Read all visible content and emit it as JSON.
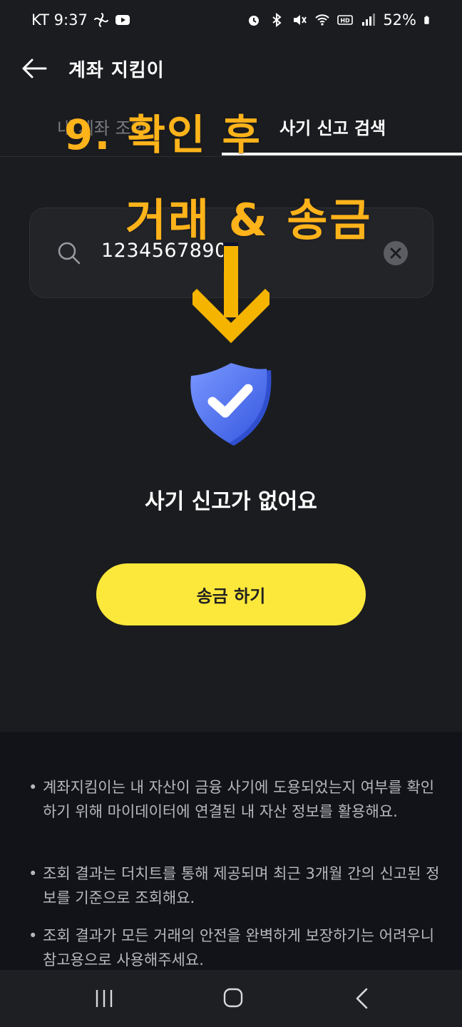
{
  "status_bar": {
    "carrier_time": "KT 9:37",
    "battery": "52%"
  },
  "header": {
    "title": "계좌 지킴이"
  },
  "tabs": {
    "left_label": "내 계좌 조회",
    "right_label": "사기 신고 검색"
  },
  "annotation": {
    "line1": "9. 확인 후",
    "line2": "거래 & 송금"
  },
  "search": {
    "value": "1234567890"
  },
  "result": {
    "message": "사기 신고가 없어요"
  },
  "send_button": {
    "label": "송금 하기"
  },
  "notes": [
    "계좌지킴이는 내 자산이 금융 사기에 도용되었는지 여부를 확인하기 위해 마이데이터에 연결된 내 자산 정보를 활용해요.",
    "조회 결과는 더치트를 통해 제공되며 최근 3개월 간의 신고된 정보를 기준으로 조회해요.",
    "조회 결과가 모든 거래의 안전을 완벽하게 보장하기는 어려우니 참고용으로 사용해주세요."
  ],
  "colors": {
    "background": "#1b1c1f",
    "accent_yellow": "#fce83a",
    "annotation_orange": "#ffb31a",
    "shield_blue": "#4a6ff0"
  },
  "icons": {
    "back": "arrow-left-icon",
    "search": "search-icon",
    "clear": "clear-icon",
    "shield": "shield-check-icon",
    "down_arrow": "arrow-down-icon"
  }
}
